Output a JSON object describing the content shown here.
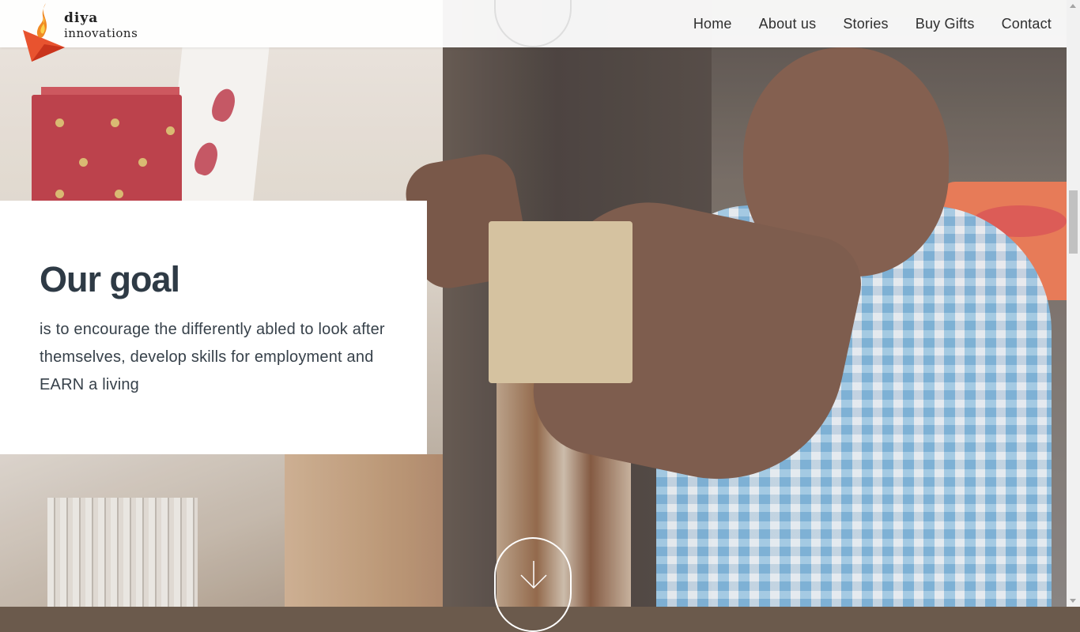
{
  "brand": {
    "name_line1": "diya",
    "name_line2": "innovations",
    "flame_color": "#f08a24",
    "triangle_color": "#e8532f"
  },
  "nav": {
    "items": [
      {
        "label": "Home"
      },
      {
        "label": "About us"
      },
      {
        "label": "Stories"
      },
      {
        "label": "Buy Gifts"
      },
      {
        "label": "Contact"
      }
    ]
  },
  "goal": {
    "title": "Our goal",
    "text": "is to encourage the differently abled to look after themselves, develop skills for employment and EARN a living"
  },
  "hero": {
    "image": "photo-artisan-folding-paper-box",
    "scroll_icon": "arrow-down-icon"
  },
  "colors": {
    "heading": "#2e3a45",
    "body_text": "#37414a",
    "nav_text": "#2f2f2f"
  }
}
